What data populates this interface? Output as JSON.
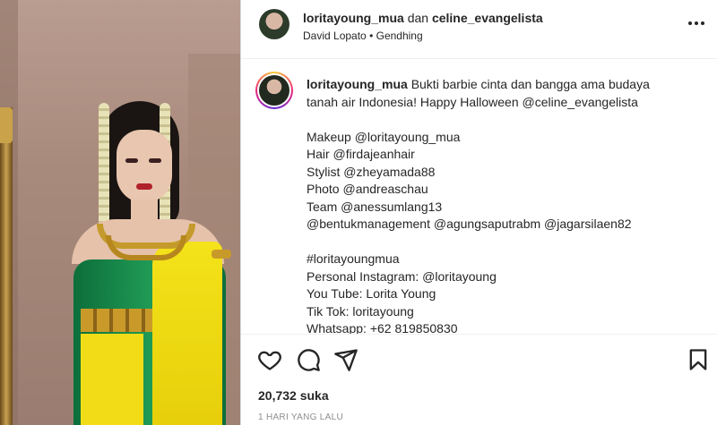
{
  "post": {
    "header": {
      "username": "loritayoung_mua",
      "connector": "dan",
      "collaborator": "celine_evangelista",
      "audio_artist": "David Lopato",
      "audio_separator": "•",
      "audio_track": "Gendhing"
    },
    "caption": {
      "author": "loritayoung_mua",
      "lines": [
        "Bukti barbie cinta dan bangga ama budaya",
        "tanah air Indonesia! Happy Halloween @celine_evangelista",
        "",
        "Makeup @loritayoung_mua",
        "Hair @firdajeanhair",
        "Stylist @zheyamada88",
        "Photo @andreaschau",
        "Team @anessumlang13",
        "@bentukmanagement @agungsaputrabm @jagarsilaen82",
        "",
        "#loritayoungmua",
        "Personal Instagram: @loritayoung",
        "You Tube: Lorita Young",
        "Tik Tok: loritayoung",
        "Whatsapp: +62 819850830"
      ]
    },
    "likes": "20,732 suka",
    "timestamp": "1 HARI YANG LALU"
  },
  "icons": {
    "more": "more-horizontal-icon",
    "like": "heart-icon",
    "comment": "comment-icon",
    "share": "send-icon",
    "save": "bookmark-icon"
  },
  "colors": {
    "text": "#262626",
    "muted": "#8e8e8e",
    "divider": "#dbdbdb"
  }
}
